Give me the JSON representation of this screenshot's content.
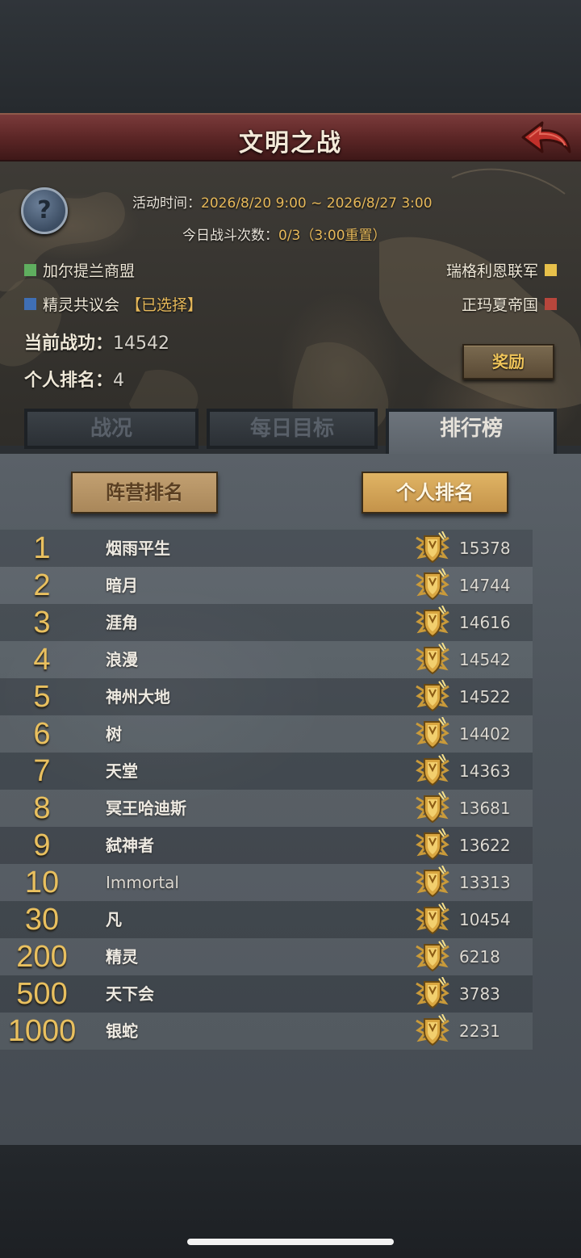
{
  "header": {
    "title": "文明之战",
    "back_icon": "back-arrow-icon"
  },
  "event": {
    "time_label": "活动时间：",
    "time_value": "2026/8/20 9:00 ~ 2026/8/27 3:00",
    "battles_label": "今日战斗次数：",
    "battles_value": "0/3（3:00重置）"
  },
  "factions": [
    {
      "name": "加尔提兰商盟",
      "color": "#5fae5f"
    },
    {
      "name": "精灵共议会",
      "selected_tag": "【已选择】",
      "color": "#3f6fb5"
    },
    {
      "name": "瑞格利恩联军",
      "color": "#e7c04a"
    },
    {
      "name": "正玛夏帝国",
      "color": "#b8463c"
    }
  ],
  "stats": {
    "merit_label": "当前战功：",
    "merit_value": "14542",
    "rank_label": "个人排名：",
    "rank_value": "4"
  },
  "reward_button": "奖励",
  "tabs": [
    {
      "label": "战况",
      "active": false
    },
    {
      "label": "每日目标",
      "active": false
    },
    {
      "label": "排行榜",
      "active": true
    }
  ],
  "ranking_buttons": {
    "camp": "阵营排名",
    "personal": "个人排名"
  },
  "rankings": [
    {
      "rank": "1",
      "name": "烟雨平生",
      "score": "15378"
    },
    {
      "rank": "2",
      "name": "暗月",
      "score": "14744"
    },
    {
      "rank": "3",
      "name": "涯角",
      "score": "14616"
    },
    {
      "rank": "4",
      "name": "浪漫",
      "score": "14542"
    },
    {
      "rank": "5",
      "name": "神州大地",
      "score": "14522"
    },
    {
      "rank": "6",
      "name": "树",
      "score": "14402"
    },
    {
      "rank": "7",
      "name": "天堂",
      "score": "14363"
    },
    {
      "rank": "8",
      "name": "冥王哈迪斯",
      "score": "13681"
    },
    {
      "rank": "9",
      "name": "弑神者",
      "score": "13622"
    },
    {
      "rank": "10",
      "name": "Immortal",
      "score": "13313"
    },
    {
      "rank": "30",
      "name": "凡",
      "score": "10454"
    },
    {
      "rank": "200",
      "name": "精灵",
      "score": "6218"
    },
    {
      "rank": "500",
      "name": "天下会",
      "score": "3783"
    },
    {
      "rank": "1000",
      "name": "银蛇",
      "score": "2231"
    }
  ]
}
